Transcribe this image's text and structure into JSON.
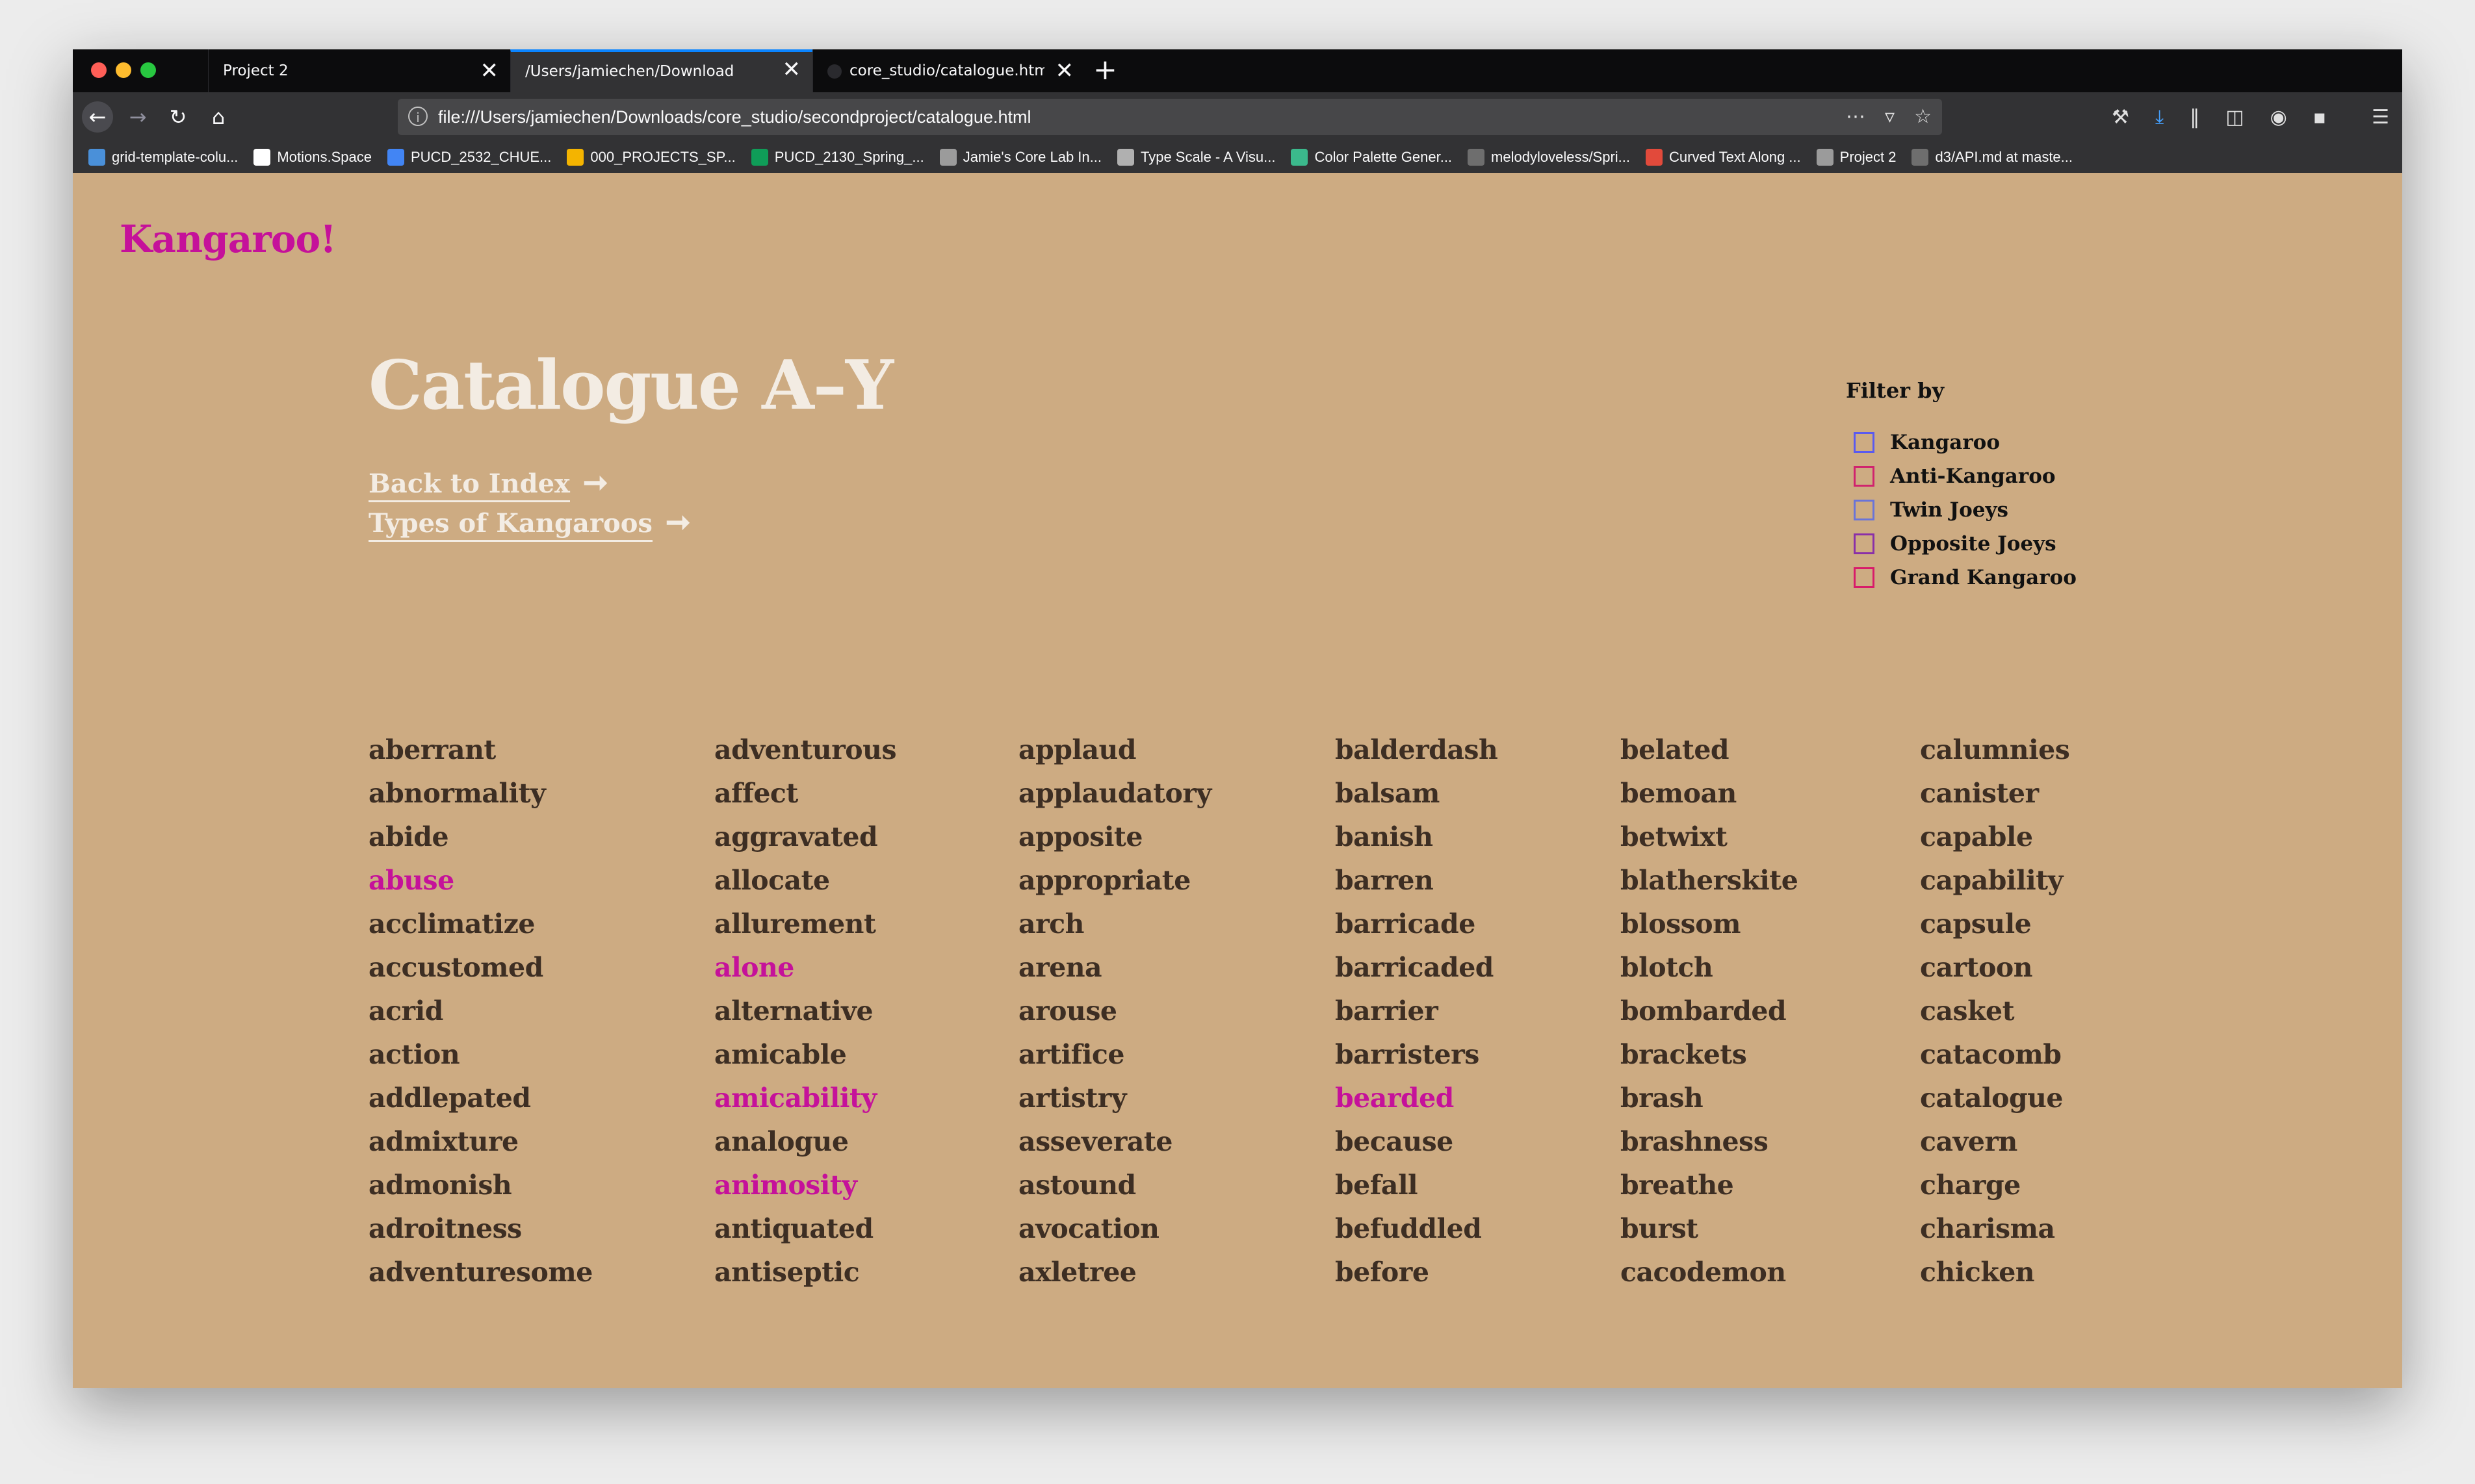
{
  "browser": {
    "tabs": [
      {
        "title": "Project 2",
        "active": false
      },
      {
        "title": "/Users/jamiechen/Downloads/core_",
        "active": true
      },
      {
        "title": "core_studio/catalogue.html at (",
        "active": false
      }
    ],
    "new_tab_icon": "plus-icon",
    "url": "file:///Users/jamiechen/Downloads/core_studio/secondproject/catalogue.html",
    "bookmarks": [
      {
        "label": "grid-template-colu...",
        "color": "#4a90d9"
      },
      {
        "label": "Motions.Space",
        "color": "#ffffff"
      },
      {
        "label": "PUCD_2532_CHUE...",
        "color": "#4285f4"
      },
      {
        "label": "000_PROJECTS_SP...",
        "color": "#f4b400"
      },
      {
        "label": "PUCD_2130_Spring_...",
        "color": "#0f9d58"
      },
      {
        "label": "Jamie's Core Lab In...",
        "color": "#9b9b9b"
      },
      {
        "label": "Type Scale - A Visu...",
        "color": "#b0b0b0"
      },
      {
        "label": "Color Palette Gener...",
        "color": "#3bb98c"
      },
      {
        "label": "melodyloveless/Spri...",
        "color": "#6e6e6e"
      },
      {
        "label": "Curved Text Along ...",
        "color": "#e24a3b"
      },
      {
        "label": "Project 2",
        "color": "#9b9b9b"
      },
      {
        "label": "d3/API.md at maste...",
        "color": "#6e6e6e"
      }
    ]
  },
  "page": {
    "logo": "Kangaroo!",
    "title": "Catalogue A–Y",
    "links": [
      {
        "label": "Back to Index",
        "arrow": "➞"
      },
      {
        "label": "Types of Kangaroos",
        "arrow": "➞"
      }
    ],
    "filter": {
      "title": "Filter by",
      "options": [
        {
          "label": "Kangaroo",
          "color": "#5a5af0"
        },
        {
          "label": "Anti-Kangaroo",
          "color": "#d0236e"
        },
        {
          "label": "Twin Joeys",
          "color": "#6a74d8"
        },
        {
          "label": "Opposite Joeys",
          "color": "#8a2fa8"
        },
        {
          "label": "Grand Kangaroo",
          "color": "#d81b6a"
        }
      ]
    },
    "accent_color": "#c5119a",
    "columns": [
      [
        {
          "w": "aberrant"
        },
        {
          "w": "abnormality"
        },
        {
          "w": "abide"
        },
        {
          "w": "abuse",
          "hl": true
        },
        {
          "w": "acclimatize"
        },
        {
          "w": "accustomed"
        },
        {
          "w": "acrid"
        },
        {
          "w": "action"
        },
        {
          "w": "addlepated"
        },
        {
          "w": "admixture"
        },
        {
          "w": "admonish"
        },
        {
          "w": "adroitness"
        },
        {
          "w": "adventuresome"
        }
      ],
      [
        {
          "w": "adventurous"
        },
        {
          "w": "affect"
        },
        {
          "w": "aggravated"
        },
        {
          "w": "allocate"
        },
        {
          "w": "allurement"
        },
        {
          "w": "alone",
          "hl": true
        },
        {
          "w": "alternative"
        },
        {
          "w": "amicable"
        },
        {
          "w": "amicability",
          "hl": true
        },
        {
          "w": "analogue"
        },
        {
          "w": "animosity",
          "hl": true
        },
        {
          "w": "antiquated"
        },
        {
          "w": "antiseptic"
        }
      ],
      [
        {
          "w": "applaud"
        },
        {
          "w": "applaudatory"
        },
        {
          "w": "apposite"
        },
        {
          "w": "appropriate"
        },
        {
          "w": "arch"
        },
        {
          "w": "arena"
        },
        {
          "w": "arouse"
        },
        {
          "w": "artifice"
        },
        {
          "w": "artistry"
        },
        {
          "w": "asseverate"
        },
        {
          "w": "astound"
        },
        {
          "w": "avocation"
        },
        {
          "w": "axletree"
        }
      ],
      [
        {
          "w": "balderdash"
        },
        {
          "w": "balsam"
        },
        {
          "w": "banish"
        },
        {
          "w": "barren"
        },
        {
          "w": "barricade"
        },
        {
          "w": "barricaded"
        },
        {
          "w": "barrier"
        },
        {
          "w": "barristers"
        },
        {
          "w": "bearded",
          "hl": true
        },
        {
          "w": "because"
        },
        {
          "w": "befall"
        },
        {
          "w": "befuddled"
        },
        {
          "w": "before"
        }
      ],
      [
        {
          "w": "belated"
        },
        {
          "w": "bemoan"
        },
        {
          "w": "betwixt"
        },
        {
          "w": "blatherskite"
        },
        {
          "w": "blossom"
        },
        {
          "w": "blotch"
        },
        {
          "w": "bombarded"
        },
        {
          "w": "brackets"
        },
        {
          "w": "brash"
        },
        {
          "w": "brashness"
        },
        {
          "w": "breathe"
        },
        {
          "w": "burst"
        },
        {
          "w": "cacodemon"
        }
      ],
      [
        {
          "w": "calumnies"
        },
        {
          "w": "canister"
        },
        {
          "w": "capable"
        },
        {
          "w": "capability"
        },
        {
          "w": "capsule"
        },
        {
          "w": "cartoon"
        },
        {
          "w": "casket"
        },
        {
          "w": "catacomb"
        },
        {
          "w": "catalogue"
        },
        {
          "w": "cavern"
        },
        {
          "w": "charge"
        },
        {
          "w": "charisma"
        },
        {
          "w": "chicken"
        }
      ]
    ]
  }
}
